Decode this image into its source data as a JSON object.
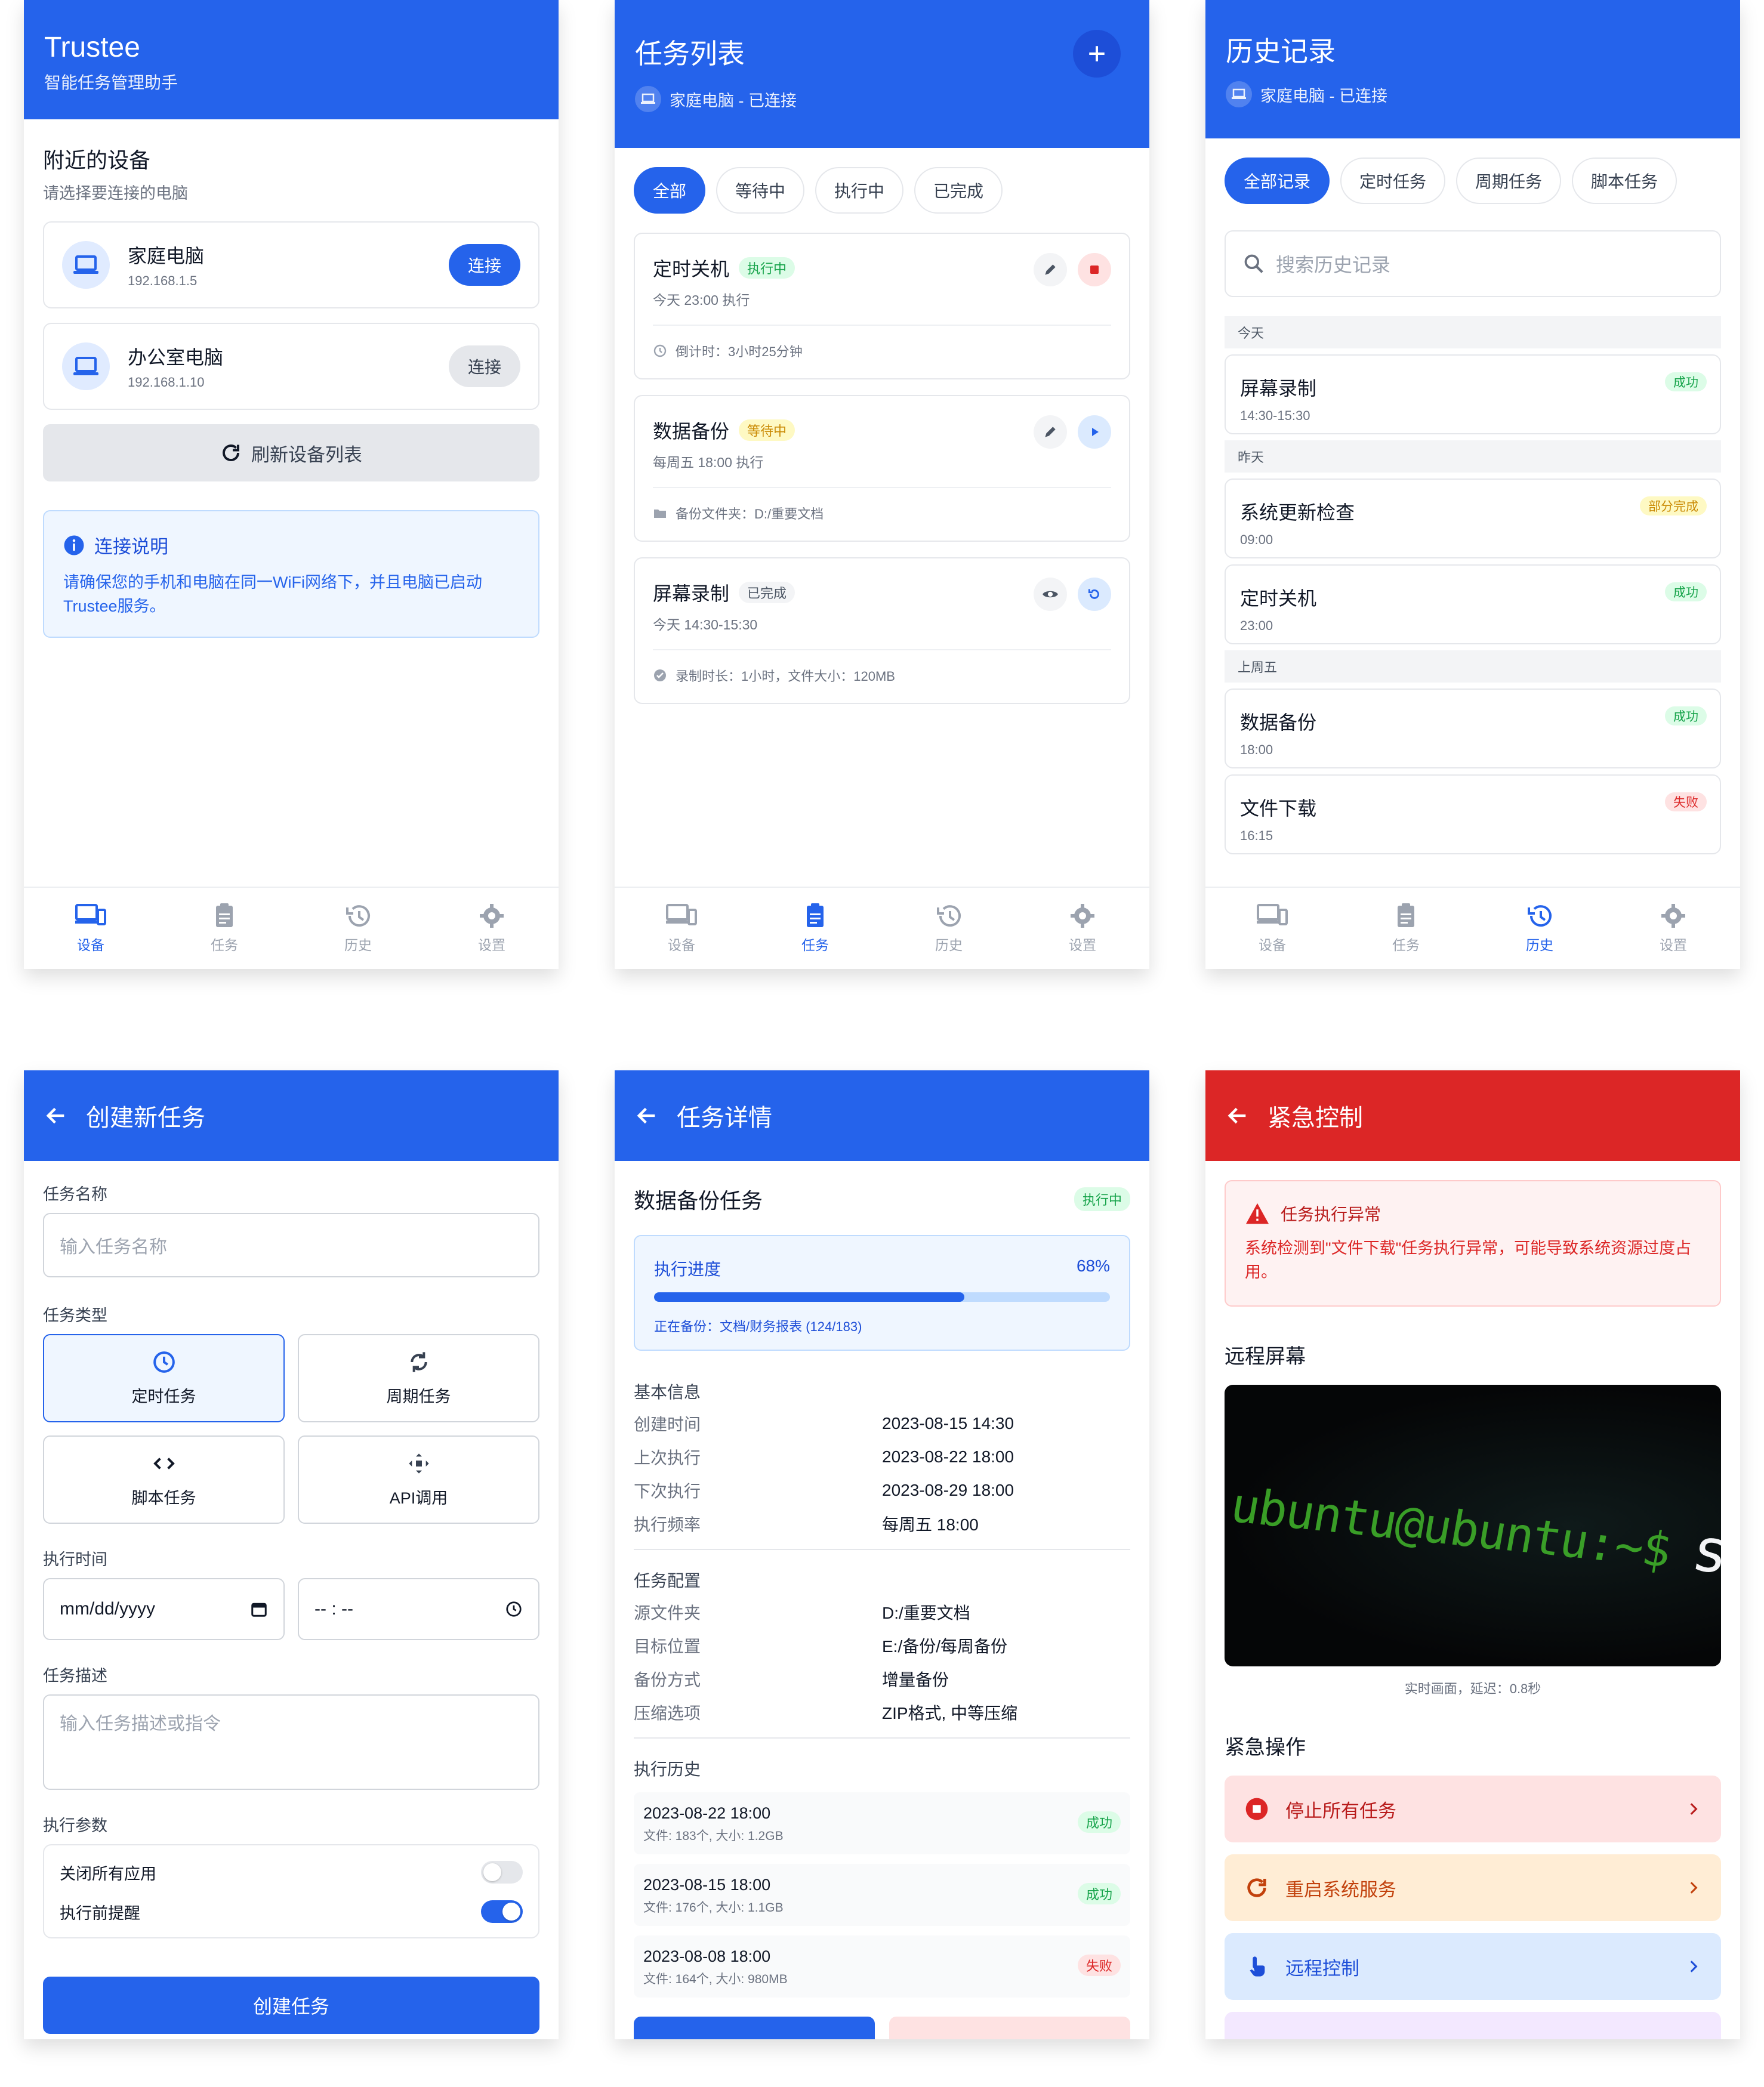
{
  "devices_screen": {
    "app_title": "Trustee",
    "app_subtitle": "智能任务管理助手",
    "section_title": "附近的设备",
    "section_hint": "请选择要连接的电脑",
    "devices": [
      {
        "name": "家庭电脑",
        "ip": "192.168.1.5",
        "button": "连接"
      },
      {
        "name": "办公室电脑",
        "ip": "192.168.1.10",
        "button": "连接"
      }
    ],
    "refresh_label": "刷新设备列表",
    "info_title": "连接说明",
    "info_text": "请确保您的手机和电脑在同一WiFi网络下，并且电脑已启动Trustee服务。"
  },
  "nav": {
    "devices": "设备",
    "tasks": "任务",
    "history": "历史",
    "settings": "设置"
  },
  "tasks_screen": {
    "title": "任务列表",
    "connection": "家庭电脑 - 已连接",
    "tabs": [
      "全部",
      "等待中",
      "执行中",
      "已完成"
    ],
    "tasks": [
      {
        "name": "定时关机",
        "status": "执行中",
        "time": "今天 23:00 执行",
        "footer": "倒计时：3小时25分钟"
      },
      {
        "name": "数据备份",
        "status": "等待中",
        "time": "每周五 18:00 执行",
        "footer": "备份文件夹：D:/重要文档"
      },
      {
        "name": "屏幕录制",
        "status": "已完成",
        "time": "今天 14:30-15:30",
        "footer": "录制时长：1小时，文件大小：120MB"
      }
    ]
  },
  "history_screen": {
    "title": "历史记录",
    "connection": "家庭电脑 - 已连接",
    "tabs": [
      "全部记录",
      "定时任务",
      "周期任务",
      "脚本任务"
    ],
    "search_placeholder": "搜索历史记录",
    "groups": [
      {
        "label": "今天",
        "items": [
          {
            "name": "屏幕录制",
            "time": "14:30-15:30",
            "status": "成功"
          }
        ]
      },
      {
        "label": "昨天",
        "items": [
          {
            "name": "系统更新检查",
            "time": "09:00",
            "status": "部分完成"
          },
          {
            "name": "定时关机",
            "time": "23:00",
            "status": "成功"
          }
        ]
      },
      {
        "label": "上周五",
        "items": [
          {
            "name": "数据备份",
            "time": "18:00",
            "status": "成功"
          },
          {
            "name": "文件下载",
            "time": "16:15",
            "status": "失败"
          }
        ]
      }
    ]
  },
  "create_screen": {
    "title": "创建新任务",
    "name_label": "任务名称",
    "name_placeholder": "输入任务名称",
    "type_label": "任务类型",
    "types": [
      "定时任务",
      "周期任务",
      "脚本任务",
      "API调用"
    ],
    "time_label": "执行时间",
    "date_placeholder": "mm/dd/yyyy",
    "time_placeholder": "-- : --",
    "desc_label": "任务描述",
    "desc_placeholder": "输入任务描述或指令",
    "params_label": "执行参数",
    "params": [
      {
        "label": "关闭所有应用",
        "on": false
      },
      {
        "label": "执行前提醒",
        "on": true
      }
    ],
    "submit": "创建任务"
  },
  "detail_screen": {
    "title": "任务详情",
    "task_name": "数据备份任务",
    "status": "执行中",
    "progress_label": "执行进度",
    "progress_text": "68%",
    "progress": 0.68,
    "progress_note": "正在备份：文档/财务报表 (124/183)",
    "basic_title": "基本信息",
    "basic": [
      {
        "k": "创建时间",
        "v": "2023-08-15 14:30"
      },
      {
        "k": "上次执行",
        "v": "2023-08-22 18:00"
      },
      {
        "k": "下次执行",
        "v": "2023-08-29 18:00"
      },
      {
        "k": "执行频率",
        "v": "每周五 18:00"
      }
    ],
    "config_title": "任务配置",
    "config": [
      {
        "k": "源文件夹",
        "v": "D:/重要文档"
      },
      {
        "k": "目标位置",
        "v": "E:/备份/每周备份"
      },
      {
        "k": "备份方式",
        "v": "增量备份"
      },
      {
        "k": "压缩选项",
        "v": "ZIP格式, 中等压缩"
      }
    ],
    "history_title": "执行历史",
    "runs": [
      {
        "date": "2023-08-22 18:00",
        "info": "文件: 183个, 大小: 1.2GB",
        "status": "成功"
      },
      {
        "date": "2023-08-15 18:00",
        "info": "文件: 176个, 大小: 1.1GB",
        "status": "成功"
      },
      {
        "date": "2023-08-08 18:00",
        "info": "文件: 164个, 大小: 980MB",
        "status": "失败"
      }
    ]
  },
  "emergency_screen": {
    "title": "紧急控制",
    "alert_title": "任务执行异常",
    "alert_text": "系统检测到\"文件下载\"任务执行异常，可能导致系统资源过度占用。",
    "remote_title": "远程屏幕",
    "terminal_prompt": "ubuntu@ubuntu:~$",
    "terminal_cmd": "sudo",
    "screen_caption": "实时画面，延迟：0.8秒",
    "actions_title": "紧急操作",
    "actions": [
      "停止所有任务",
      "重启系统服务",
      "远程控制"
    ]
  },
  "colors": {
    "primary": "#2563eb",
    "danger": "#dc2626",
    "success": "#16a34a",
    "warning": "#ca8a04"
  }
}
